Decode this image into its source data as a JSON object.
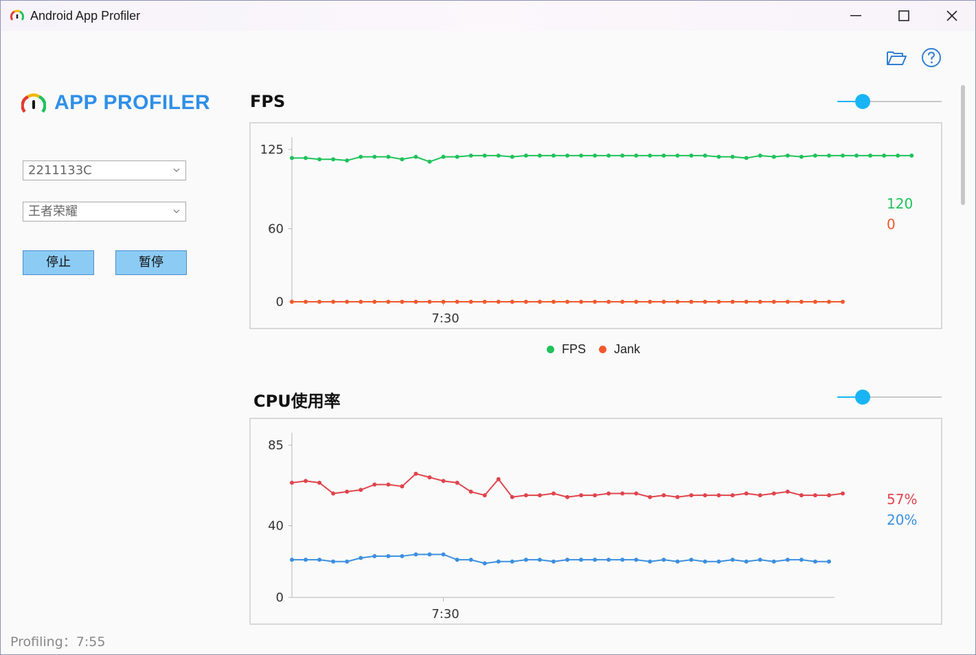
{
  "window": {
    "title": "Android App Profiler",
    "minimize_label": "—",
    "close_label": "✕"
  },
  "toolbar": {
    "open_icon": "folder-open-icon",
    "help_icon": "help-circle-icon"
  },
  "sidebar": {
    "brand": "APP PROFILER",
    "device_select": "2211133C",
    "app_select": "王者荣耀",
    "stop_label": "停止",
    "pause_label": "暂停"
  },
  "status": {
    "text": "Profiling：7:55"
  },
  "colors": {
    "fps": "#1ec25a",
    "jank": "#f0582c",
    "cpu_total": "#e0444c",
    "cpu_app": "#3b8fe0",
    "accent": "#2f8fe8",
    "slider": "#19b4f5"
  },
  "fps_section": {
    "title": "FPS",
    "slider_value": 0.2,
    "current_fps": "120",
    "current_jank": "0",
    "legend_fps": "FPS",
    "legend_jank": "Jank"
  },
  "cpu_section": {
    "title": "CPU使用率",
    "slider_value": 0.2,
    "current_total": "57%",
    "current_app": "20%"
  },
  "chart_data": [
    {
      "type": "line",
      "title": "FPS",
      "ylim": [
        0,
        125
      ],
      "y_ticks": [
        "125",
        "60",
        "0"
      ],
      "y_tick_values": [
        125,
        60,
        0
      ],
      "x_tick_labels": [
        "7:30"
      ],
      "x_tick_index": 11,
      "legend": "bottom",
      "series": [
        {
          "name": "FPS",
          "color": "#1ec25a",
          "values": [
            118,
            118,
            117,
            117,
            116,
            119,
            119,
            119,
            117,
            119,
            115,
            119,
            119,
            120,
            120,
            120,
            119,
            120,
            120,
            120,
            120,
            120,
            120,
            120,
            120,
            120,
            120,
            120,
            120,
            120,
            120,
            119,
            119,
            118,
            120,
            119,
            120,
            119,
            120,
            120,
            120,
            120,
            120,
            120,
            120,
            120
          ]
        },
        {
          "name": "Jank",
          "color": "#f0582c",
          "values": [
            0,
            0,
            0,
            0,
            0,
            0,
            0,
            0,
            0,
            0,
            0,
            0,
            0,
            0,
            0,
            0,
            0,
            0,
            0,
            0,
            0,
            0,
            0,
            0,
            0,
            0,
            0,
            0,
            0,
            0,
            0,
            0,
            0,
            0,
            0,
            0,
            0,
            0,
            0,
            0,
            0
          ]
        }
      ]
    },
    {
      "type": "line",
      "title": "CPU使用率",
      "ylim": [
        0,
        85
      ],
      "y_ticks": [
        "85",
        "40",
        "0"
      ],
      "y_tick_values": [
        85,
        40,
        0
      ],
      "x_tick_labels": [
        "7:30"
      ],
      "x_tick_index": 11,
      "series": [
        {
          "color": "#e0444c",
          "values": [
            64,
            65,
            64,
            58,
            59,
            60,
            63,
            63,
            62,
            69,
            67,
            65,
            64,
            59,
            57,
            66,
            56,
            57,
            57,
            58,
            56,
            57,
            57,
            58,
            58,
            58,
            56,
            57,
            56,
            57,
            57,
            57,
            57,
            58,
            57,
            58,
            59,
            57,
            57,
            57,
            58
          ]
        },
        {
          "color": "#3b8fe0",
          "values": [
            21,
            21,
            21,
            20,
            20,
            22,
            23,
            23,
            23,
            24,
            24,
            24,
            21,
            21,
            19,
            20,
            20,
            21,
            21,
            20,
            21,
            21,
            21,
            21,
            21,
            21,
            20,
            21,
            20,
            21,
            20,
            20,
            21,
            20,
            21,
            20,
            21,
            21,
            20,
            20
          ]
        }
      ]
    }
  ]
}
